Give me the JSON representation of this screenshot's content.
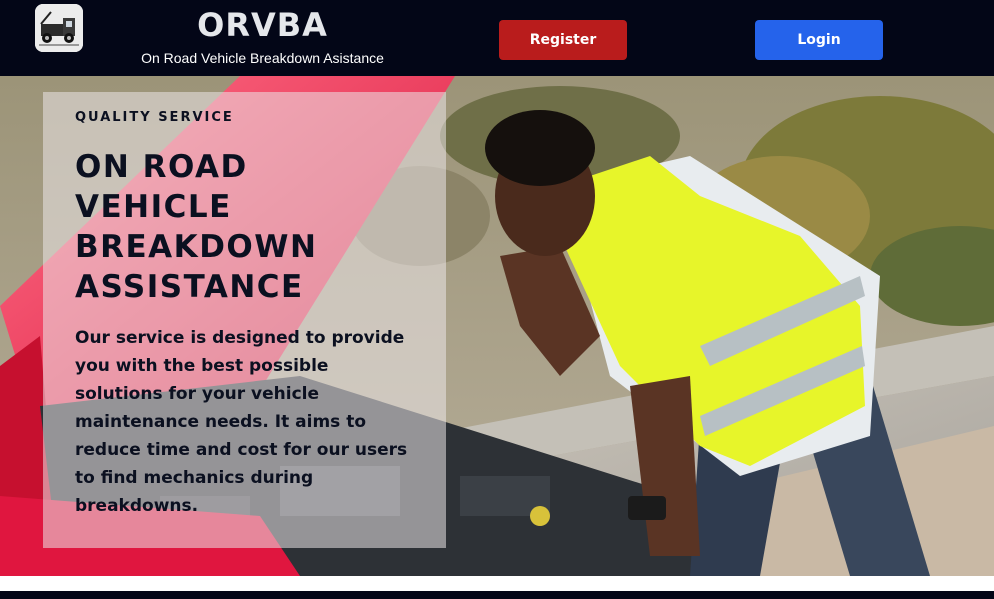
{
  "header": {
    "brand_title": "ORVBA",
    "brand_subtitle": "On Road Vehicle Breakdown Asistance",
    "logo_icon": "tow-truck-icon",
    "register_label": "Register",
    "login_label": "Login"
  },
  "hero": {
    "kicker": "QUALITY SERVICE",
    "headline_lines": [
      "ON ROAD",
      "VEHICLE",
      "BREAKDOWN",
      "ASSISTANCE"
    ],
    "description": "Our service is designed to provide you with the best possible solutions for your vehicle maintenance needs. It aims to reduce time and cost for our users to find mechanics during breakdowns."
  },
  "colors": {
    "header_bg": "#030617",
    "register_bg": "#b91c1c",
    "login_bg": "#2563eb",
    "text_dark": "#0b1020"
  }
}
